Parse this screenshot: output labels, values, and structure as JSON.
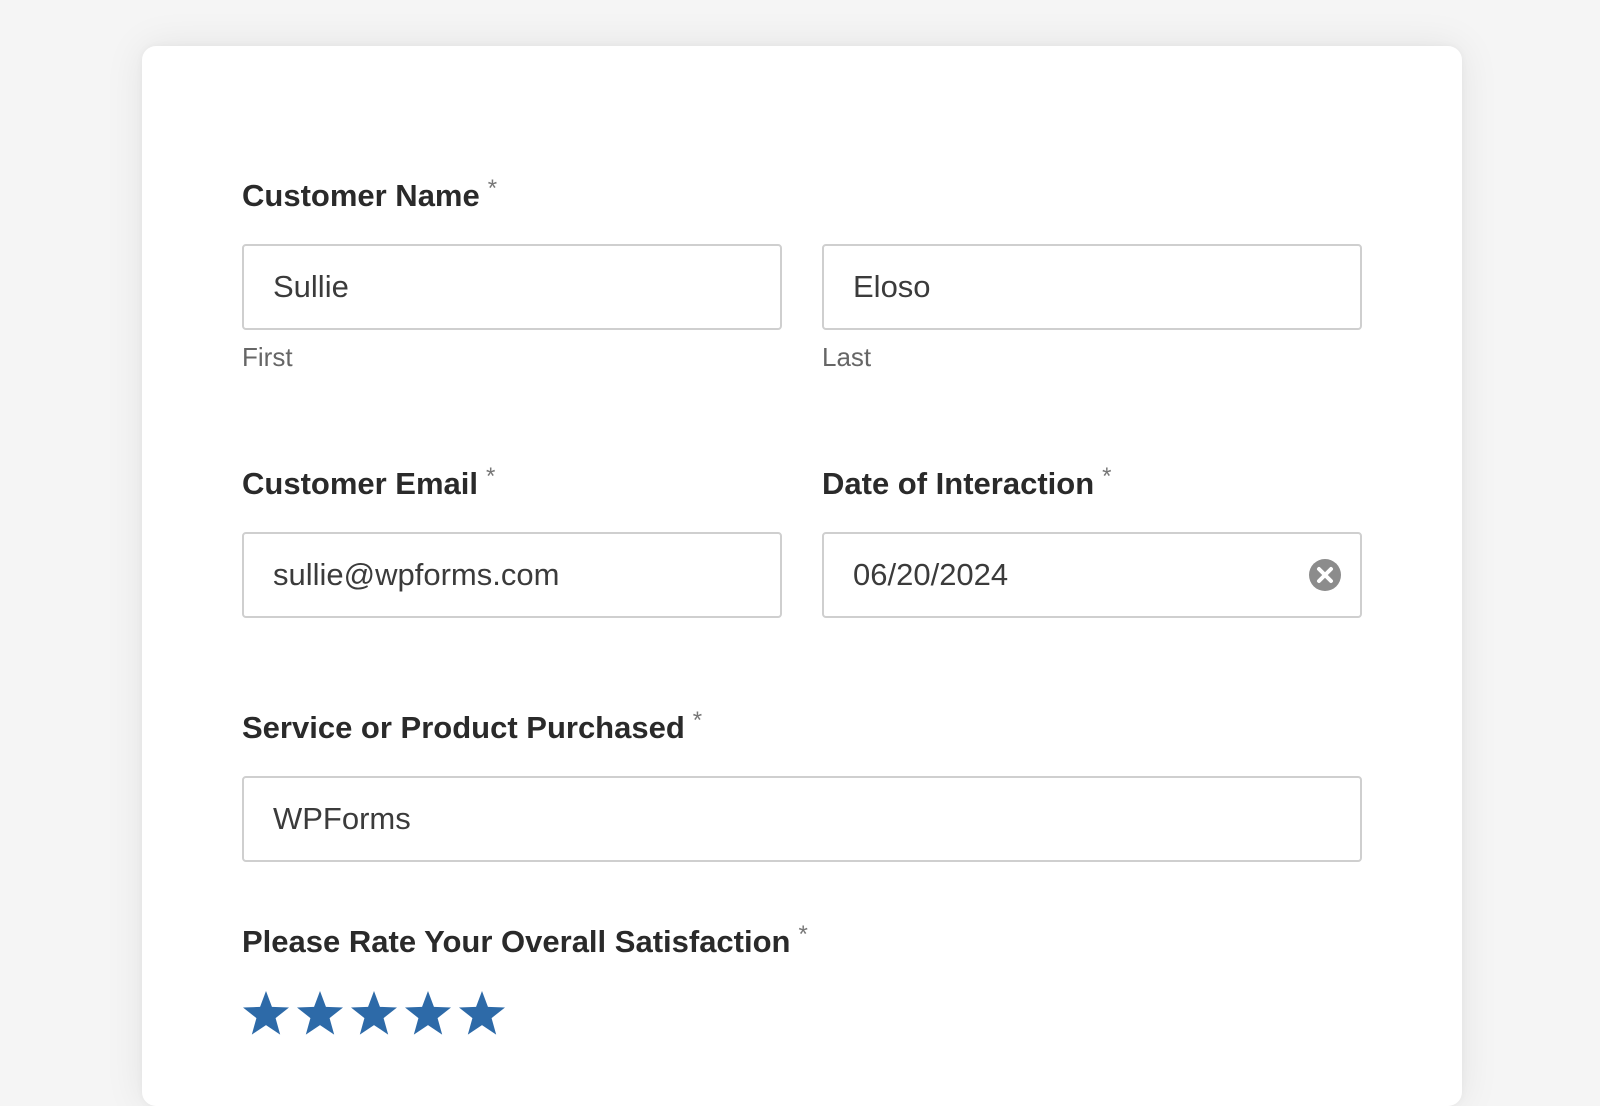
{
  "colors": {
    "page_background": "#f5f5f5",
    "card_background": "#ffffff",
    "star_color": "#2d6aa8",
    "input_border": "#cfcfcf",
    "clear_icon": "#8c8c8c"
  },
  "form": {
    "required_marker": "*",
    "customer_name": {
      "label": "Customer Name",
      "first_value": "Sullie",
      "first_sublabel": "First",
      "last_value": "Eloso",
      "last_sublabel": "Last"
    },
    "customer_email": {
      "label": "Customer Email",
      "value": "sullie@wpforms.com"
    },
    "date_of_interaction": {
      "label": "Date of Interaction",
      "value": "06/20/2024",
      "clear_icon": "close-circle-icon"
    },
    "service_product": {
      "label": "Service or Product Purchased",
      "value": "WPForms"
    },
    "satisfaction": {
      "label": "Please Rate Your Overall Satisfaction",
      "rating": 5,
      "max_rating": 5,
      "star_icon": "star-icon"
    }
  }
}
